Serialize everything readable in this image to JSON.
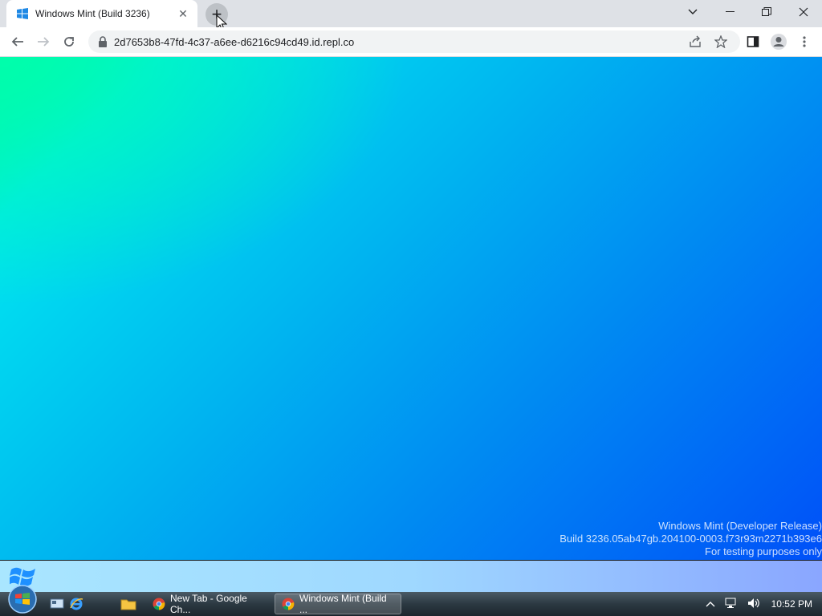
{
  "browser": {
    "tab_title": "Windows Mint (Build 3236)",
    "url": "2d7653b8-47fd-4c37-a6ee-d6216c94cd49.id.repl.co"
  },
  "desktop": {
    "watermark_line1": "Windows Mint (Developer Release)",
    "watermark_line2": "Build 3236.05ab47gb.204100-0003.f73r93m2271b393e6",
    "watermark_line3": "For testing purposes only"
  },
  "taskbar": {
    "tasks": [
      {
        "label": "New Tab - Google Ch..."
      },
      {
        "label": "Windows Mint (Build ..."
      }
    ],
    "clock": "10:52 PM"
  },
  "colors": {
    "chrome_tabstrip": "#dee1e6",
    "accent": "#1a73e8"
  }
}
